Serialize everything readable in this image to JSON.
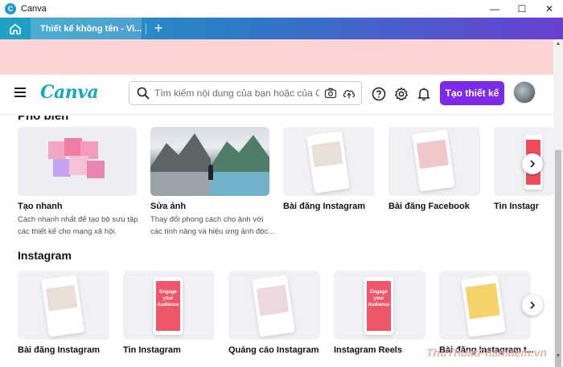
{
  "window": {
    "app_title": "Canva",
    "icon_letter": "C",
    "minimize": "—",
    "maximize": "☐",
    "close": "✕"
  },
  "tabs": [
    {
      "label": "Thiết kế không tên - Vi..."
    }
  ],
  "new_tab": "+",
  "header": {
    "logo": "Canva",
    "search_placeholder": "Tìm kiếm nội dung của bạn hoặc của Canv",
    "create_button": "Tạo thiết kế"
  },
  "section_cut_title": "Pho biến",
  "row1": [
    {
      "title": "Tạo nhanh",
      "desc": "Cách nhanh nhất để tạo bộ sưu tập các thiết kế cho mạng xã hội."
    },
    {
      "title": "Sửa ảnh",
      "desc": "Thay đổi phong cách cho ảnh với các tính năng và hiệu ứng ảnh độc..."
    },
    {
      "title": "Bài đăng Instagram",
      "desc": ""
    },
    {
      "title": "Bài đăng Facebook",
      "desc": ""
    },
    {
      "title": "Tin Instagr",
      "desc": ""
    }
  ],
  "instagram_section": {
    "title": "Instagram",
    "cards": [
      {
        "title": "Bài đăng Instagram"
      },
      {
        "title": "Tin Instagram"
      },
      {
        "title": "Quảng cáo Instagram"
      },
      {
        "title": "Instagram Reels"
      },
      {
        "title": "Bài đăng Instagram t..."
      }
    ]
  },
  "thumb_text": {
    "engage": "Engage",
    "your": "your",
    "audience": "Audience"
  },
  "watermark": "ThuThuatPhanMem.vn",
  "colors": {
    "accent": "#7d2ae8",
    "banner": "#fdd3d3",
    "logo": "#17a8c9"
  }
}
